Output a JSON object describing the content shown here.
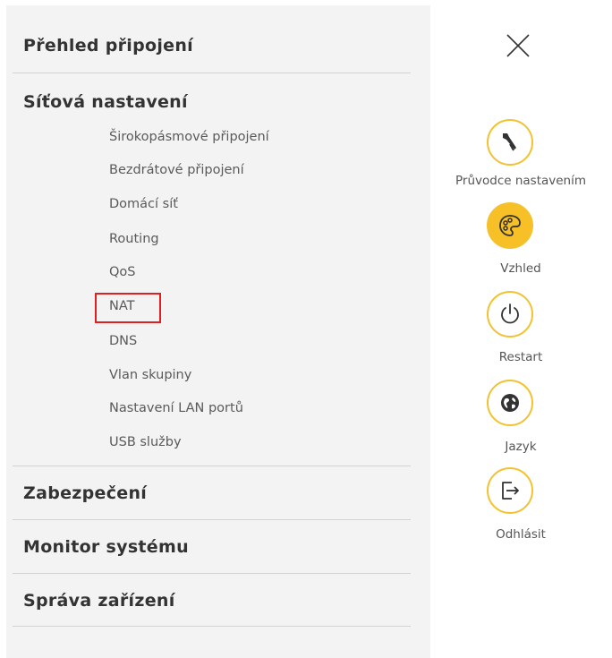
{
  "menu": {
    "overview": "Přehled připojení",
    "network_settings": {
      "label": "Síťová nastavení",
      "items": [
        "Širokopásmové připojení",
        "Bezdrátové připojení",
        "Domácí síť",
        "Routing",
        "QoS",
        "NAT",
        "DNS",
        "Vlan skupiny",
        "Nastavení LAN portů",
        "USB služby"
      ]
    },
    "security": "Zabezpečení",
    "system_monitor": "Monitor systému",
    "device_management": "Správa zařízení"
  },
  "quick_actions": {
    "setup_wizard": "Průvodce nastavením",
    "theme": "Vzhled",
    "restart": "Restart",
    "language": "Jazyk",
    "logout": "Odhlásit"
  },
  "colors": {
    "accent": "#f6c026",
    "highlight_border": "#e02020",
    "menu_background": "#f3f3f3"
  }
}
